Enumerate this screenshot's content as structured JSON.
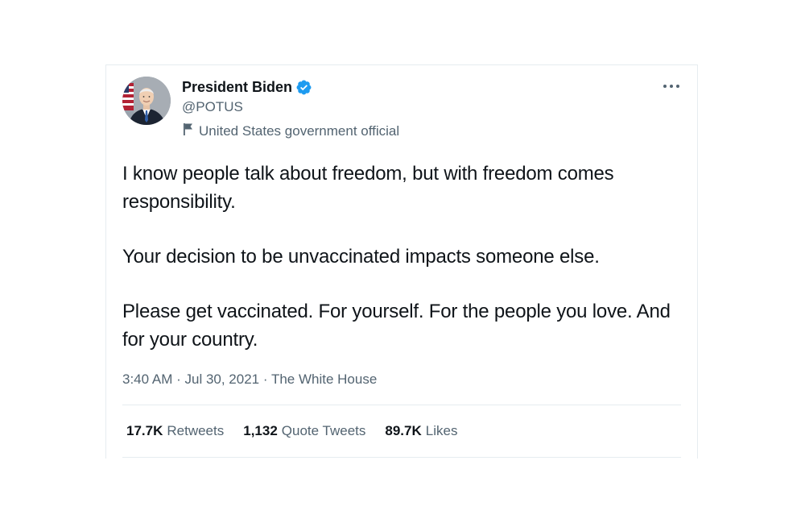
{
  "author": {
    "display_name": "President Biden",
    "handle": "@POTUS",
    "verified": true,
    "label": "United States government official",
    "avatar_icon": "avatar-photo"
  },
  "menu": {
    "more_icon": "more-horizontal-icon"
  },
  "tweet": {
    "paragraphs": [
      "I know people talk about freedom, but with freedom comes responsibility.",
      "Your decision to be unvaccinated impacts someone else.",
      "Please get vaccinated. For yourself. For the people you love. And for your country."
    ]
  },
  "meta": {
    "time": "3:40 AM",
    "separator": " · ",
    "date": "Jul 30, 2021",
    "source": "The White House"
  },
  "stats": [
    {
      "count": "17.7K",
      "label": "Retweets"
    },
    {
      "count": "1,132",
      "label": "Quote Tweets"
    },
    {
      "count": "89.7K",
      "label": "Likes"
    }
  ],
  "colors": {
    "text_primary": "#0f1419",
    "text_secondary": "#536471",
    "verified_blue": "#1d9bf0",
    "divider": "#e6ecf0"
  }
}
